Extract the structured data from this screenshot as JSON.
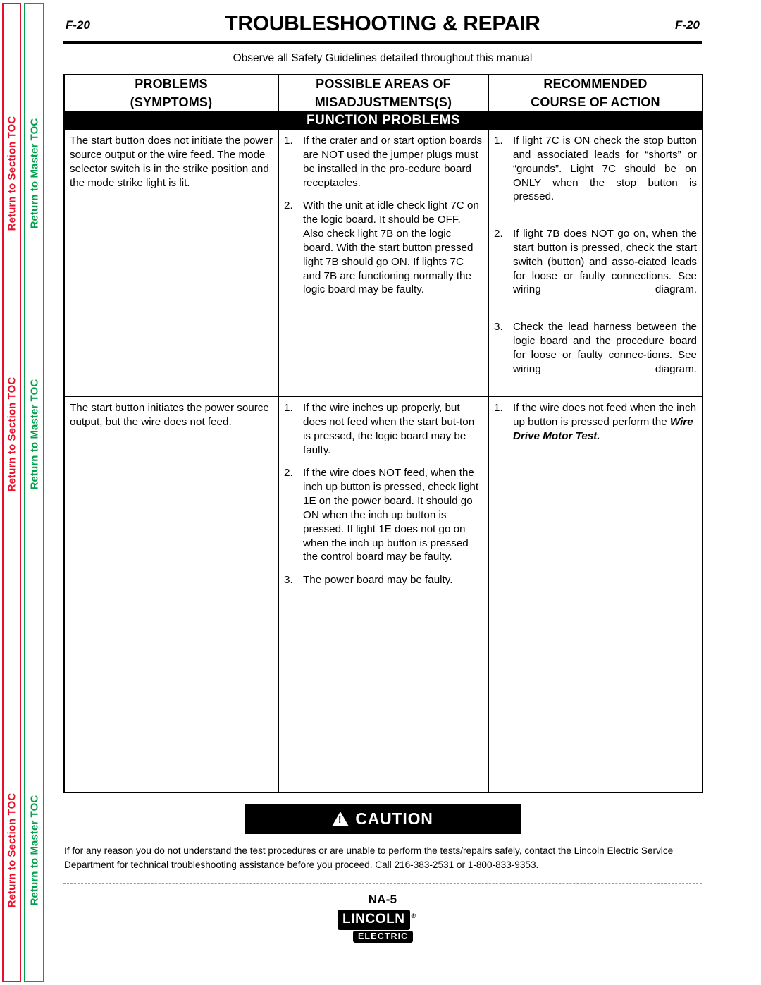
{
  "sidebar": {
    "section_toc_label": "Return to Section TOC",
    "master_toc_label": "Return to Master TOC",
    "section_toc_color": "#e8112d",
    "master_toc_color": "#00a14b",
    "repeat_count": 3
  },
  "header": {
    "folio_left": "F-20",
    "folio_right": "F-20",
    "title": "TROUBLESHOOTING & REPAIR",
    "safety_note": "Observe all Safety Guidelines detailed throughout this manual"
  },
  "table": {
    "columns": [
      {
        "line1": "PROBLEMS",
        "line2": "(SYMPTOMS)"
      },
      {
        "line1": "POSSIBLE AREAS OF",
        "line2": "MISADJUSTMENTS(S)"
      },
      {
        "line1": "RECOMMENDED",
        "line2": "COURSE OF ACTION"
      }
    ],
    "section_band": "FUNCTION  PROBLEMS",
    "rows": [
      {
        "symptom": "The start button does not initiate the power source output or the wire feed.  The mode selector switch is in the strike position and the mode strike light is lit.",
        "possible_areas": [
          {
            "num": "1.",
            "text": "If the crater and or start option boards are NOT used the jumper plugs must be installed in the pro-cedure board receptacles."
          },
          {
            "num": "2.",
            "text": "With the unit at idle check light 7C on the logic board.  It should be OFF.   Also check light 7B on the logic board.  With the start button pressed light 7B should go ON.  If lights 7C and 7B are functioning normally the logic board may be faulty."
          }
        ],
        "recommended": [
          {
            "num": "1.",
            "text": "If light 7C is ON check the stop button and associated leads for “shorts” or “grounds”.  Light 7C should be on ONLY when the stop button is pressed."
          },
          {
            "num": "2.",
            "text": "If light 7B does NOT go on, when the start button is pressed, check the start switch (button) and asso-ciated leads for loose or faulty connections.  See wiring diagram."
          },
          {
            "num": "3.",
            "text": "Check the lead harness between the logic board and the procedure board for loose or faulty connec-tions.   See  wiring  diagram."
          }
        ]
      },
      {
        "symptom": "The start button initiates the power source output, but the wire does not feed.",
        "possible_areas": [
          {
            "num": "1.",
            "text": "If the wire inches up properly, but does not feed when the start but-ton is pressed,  the logic board may be faulty."
          },
          {
            "num": "2.",
            "text": "If the wire does NOT feed, when the inch up button is pressed, check light 1E on the power board.  It should go ON when the inch up button is pressed.  If light 1E does not go on when the inch up button is pressed  the control board may be faulty."
          },
          {
            "num": "3.",
            "text": "The power board may be faulty."
          }
        ],
        "recommended": [
          {
            "num": "1.",
            "prefix": "If the wire does not feed when the inch up button is pressed perform the ",
            "emphasis": "Wire Drive Motor Test."
          }
        ]
      }
    ]
  },
  "caution": {
    "label": "CAUTION",
    "icon": "warning-triangle-icon",
    "body": "If for any reason you do not understand the test procedures or are unable to perform the tests/repairs safely, contact the Lincoln Electric Service Department for technical troubleshooting assistance before you proceed. Call 216-383-2531 or 1-800-833-9353."
  },
  "footer": {
    "model": "NA-5",
    "logo_top": "LINCOLN",
    "logo_registered": "®",
    "logo_bottom": "ELECTRIC"
  }
}
